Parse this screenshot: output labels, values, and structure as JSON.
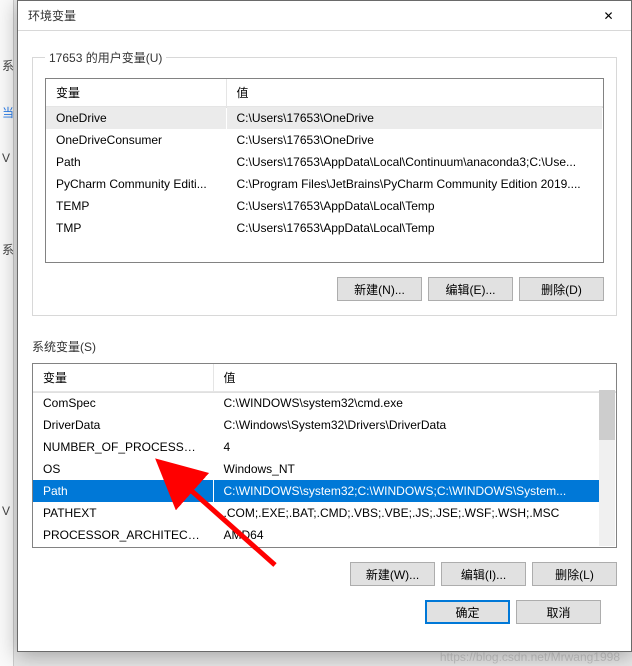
{
  "left_chars": [
    "系",
    "当",
    "V",
    "系",
    "V"
  ],
  "dialog": {
    "title": "环境变量",
    "close": "✕"
  },
  "user_group": {
    "legend": "17653 的用户变量(U)",
    "headers": {
      "name": "变量",
      "value": "值"
    },
    "rows": [
      {
        "name": "OneDrive",
        "value": "C:\\Users\\17653\\OneDrive"
      },
      {
        "name": "OneDriveConsumer",
        "value": "C:\\Users\\17653\\OneDrive"
      },
      {
        "name": "Path",
        "value": "C:\\Users\\17653\\AppData\\Local\\Continuum\\anaconda3;C:\\Use..."
      },
      {
        "name": "PyCharm Community Editi...",
        "value": "C:\\Program Files\\JetBrains\\PyCharm Community Edition 2019...."
      },
      {
        "name": "TEMP",
        "value": "C:\\Users\\17653\\AppData\\Local\\Temp"
      },
      {
        "name": "TMP",
        "value": "C:\\Users\\17653\\AppData\\Local\\Temp"
      }
    ],
    "buttons": {
      "new": "新建(N)...",
      "edit": "编辑(E)...",
      "delete": "删除(D)"
    }
  },
  "sys_group": {
    "legend": "系统变量(S)",
    "headers": {
      "name": "变量",
      "value": "值"
    },
    "rows": [
      {
        "name": "ComSpec",
        "value": "C:\\WINDOWS\\system32\\cmd.exe"
      },
      {
        "name": "DriverData",
        "value": "C:\\Windows\\System32\\Drivers\\DriverData"
      },
      {
        "name": "NUMBER_OF_PROCESSORS",
        "value": "4"
      },
      {
        "name": "OS",
        "value": "Windows_NT"
      },
      {
        "name": "Path",
        "value": "C:\\WINDOWS\\system32;C:\\WINDOWS;C:\\WINDOWS\\System..."
      },
      {
        "name": "PATHEXT",
        "value": ".COM;.EXE;.BAT;.CMD;.VBS;.VBE;.JS;.JSE;.WSF;.WSH;.MSC"
      },
      {
        "name": "PROCESSOR_ARCHITECT...",
        "value": "AMD64"
      }
    ],
    "highlighted_index": 4,
    "buttons": {
      "new": "新建(W)...",
      "edit": "编辑(I)...",
      "delete": "删除(L)"
    }
  },
  "main_buttons": {
    "ok": "确定",
    "cancel": "取消"
  },
  "watermark": "https://blog.csdn.net/Mrwang1998"
}
